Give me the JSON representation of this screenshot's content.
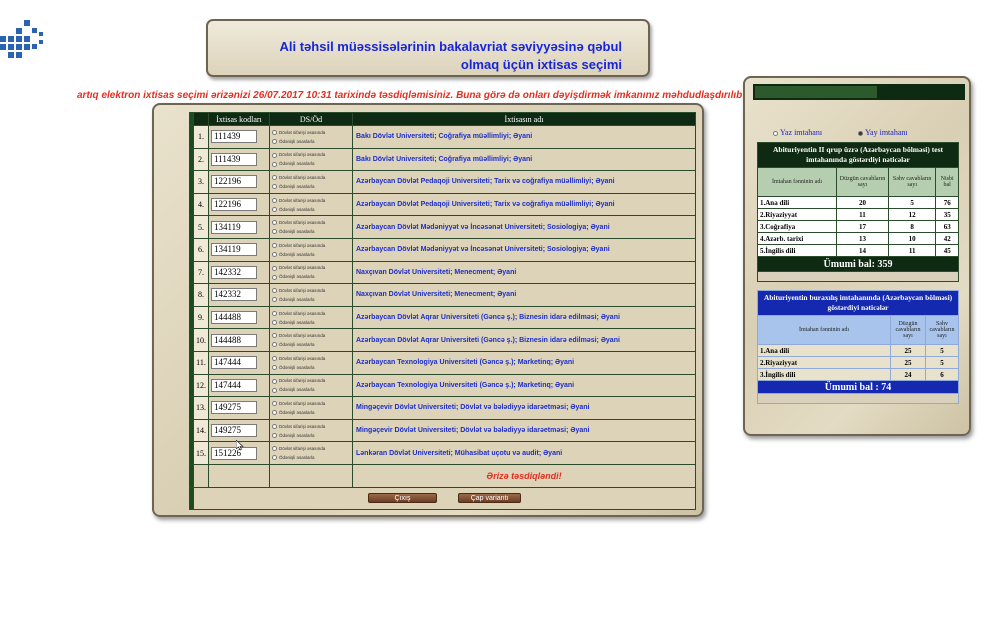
{
  "header": {
    "title_line1": "Ali təhsil müəssisələrinin bakalavriat səviyyəsinə qəbul",
    "title_line2": "olmaq üçün ixtisas seçimi"
  },
  "notice": "artıq elektron ixtisas seçimi ərizənizi 26/07.2017 10:31 tarixində təsdiqləmisiniz. Buna görə də onları dəyişdirmək imkanınız məhdudlaşdırılıb",
  "table": {
    "col_codes": "İxtisas kodları",
    "col_dsod": "DS/Öd",
    "col_name": "İxtisasın adı",
    "radio_state": "Dövlət sifarişi əsasında",
    "radio_paid": "Ödənişli əsaslarla",
    "rows": [
      {
        "num": "1.",
        "code": "111439",
        "name": "Bakı Dövlət Universiteti; Coğrafiya müəllimliyi; Əyani"
      },
      {
        "num": "2.",
        "code": "111439",
        "name": "Bakı Dövlət Universiteti; Coğrafiya müəllimliyi; Əyani"
      },
      {
        "num": "3.",
        "code": "122196",
        "name": "Azərbaycan Dövlət Pedaqoji Universiteti; Tarix və coğrafiya müəllimliyi; Əyani"
      },
      {
        "num": "4.",
        "code": "122196",
        "name": "Azərbaycan Dövlət Pedaqoji Universiteti; Tarix və coğrafiya müəllimliyi; Əyani"
      },
      {
        "num": "5.",
        "code": "134119",
        "name": "Azərbaycan Dövlət Mədəniyyət və İncəsənət Universiteti; Sosiologiya; Əyani"
      },
      {
        "num": "6.",
        "code": "134119",
        "name": "Azərbaycan Dövlət Mədəniyyət və İncəsənət Universiteti; Sosiologiya; Əyani"
      },
      {
        "num": "7.",
        "code": "142332",
        "name": "Naxçıvan Dövlət Universiteti; Menecment; Əyani"
      },
      {
        "num": "8.",
        "code": "142332",
        "name": "Naxçıvan Dövlət Universiteti; Menecment; Əyani"
      },
      {
        "num": "9.",
        "code": "144488",
        "name": "Azərbaycan Dövlət Aqrar Universiteti (Gəncə ş.); Biznesin idarə edilməsi; Əyani"
      },
      {
        "num": "10.",
        "code": "144488",
        "name": "Azərbaycan Dövlət Aqrar Universiteti (Gəncə ş.); Biznesin idarə edilməsi; Əyani"
      },
      {
        "num": "11.",
        "code": "147444",
        "name": "Azərbaycan Texnologiya Universiteti (Gəncə ş.); Marketinq; Əyani"
      },
      {
        "num": "12.",
        "code": "147444",
        "name": "Azərbaycan Texnologiya Universiteti (Gəncə ş.); Marketinq; Əyani"
      },
      {
        "num": "13.",
        "code": "149275",
        "name": "Mingəçevir Dövlət Universiteti; Dövlət və bələdiyyə idarəetməsi; Əyani"
      },
      {
        "num": "14.",
        "code": "149275",
        "name": "Mingəçevir Dövlət Universiteti; Dövlət və bələdiyyə idarəetməsi; Əyani"
      },
      {
        "num": "15.",
        "code": "151226",
        "name": "Lənkəran Dövlət Universiteti; Mühasibat uçotu və audit; Əyani"
      }
    ],
    "status": "Ərizə təsdiqləndi!",
    "exit_button": "Çıxış",
    "print_button": "Çap variantı"
  },
  "results": {
    "radio_winter": "Yaz imtahanı",
    "radio_summer": "Yay imtahanı",
    "test_caption": "Abituriyentin II qrup üzrə (Azərbaycan bölməsi) test imtahanında göstərdiyi nəticələr",
    "col_subject": "İmtahan fənninin adı",
    "col_correct": "Düzgün cavabların sayı",
    "col_wrong": "Səhv cavabların sayı",
    "col_score": "Nisbi bal",
    "test_rows": [
      {
        "subject": "1.Ana dili",
        "correct": "20",
        "wrong": "5",
        "score": "76"
      },
      {
        "subject": "2.Riyaziyyat",
        "correct": "11",
        "wrong": "12",
        "score": "35"
      },
      {
        "subject": "3.Coğrafiya",
        "correct": "17",
        "wrong": "8",
        "score": "63"
      },
      {
        "subject": "4.Azərb. tarixi",
        "correct": "13",
        "wrong": "10",
        "score": "42"
      },
      {
        "subject": "5.İngilis dili",
        "correct": "14",
        "wrong": "11",
        "score": "45"
      }
    ],
    "test_total": "Ümumi bal: 359",
    "grad_caption": "Abituriyentin buraxılış imtahanında (Azərbaycan bölməsi) göstərdiyi nəticələr",
    "grad_rows": [
      {
        "subject": "1.Ana dili",
        "correct": "25",
        "wrong": "5"
      },
      {
        "subject": "2.Riyaziyyat",
        "correct": "25",
        "wrong": "5"
      },
      {
        "subject": "3.İngilis dili",
        "correct": "24",
        "wrong": "6"
      }
    ],
    "grad_total": "Ümumi bal : 74"
  },
  "colors": {
    "accent_blue": "#1726d8",
    "notice_red": "#e03020",
    "dark_green": "#0f2a12",
    "result_blue": "#1428b0"
  }
}
